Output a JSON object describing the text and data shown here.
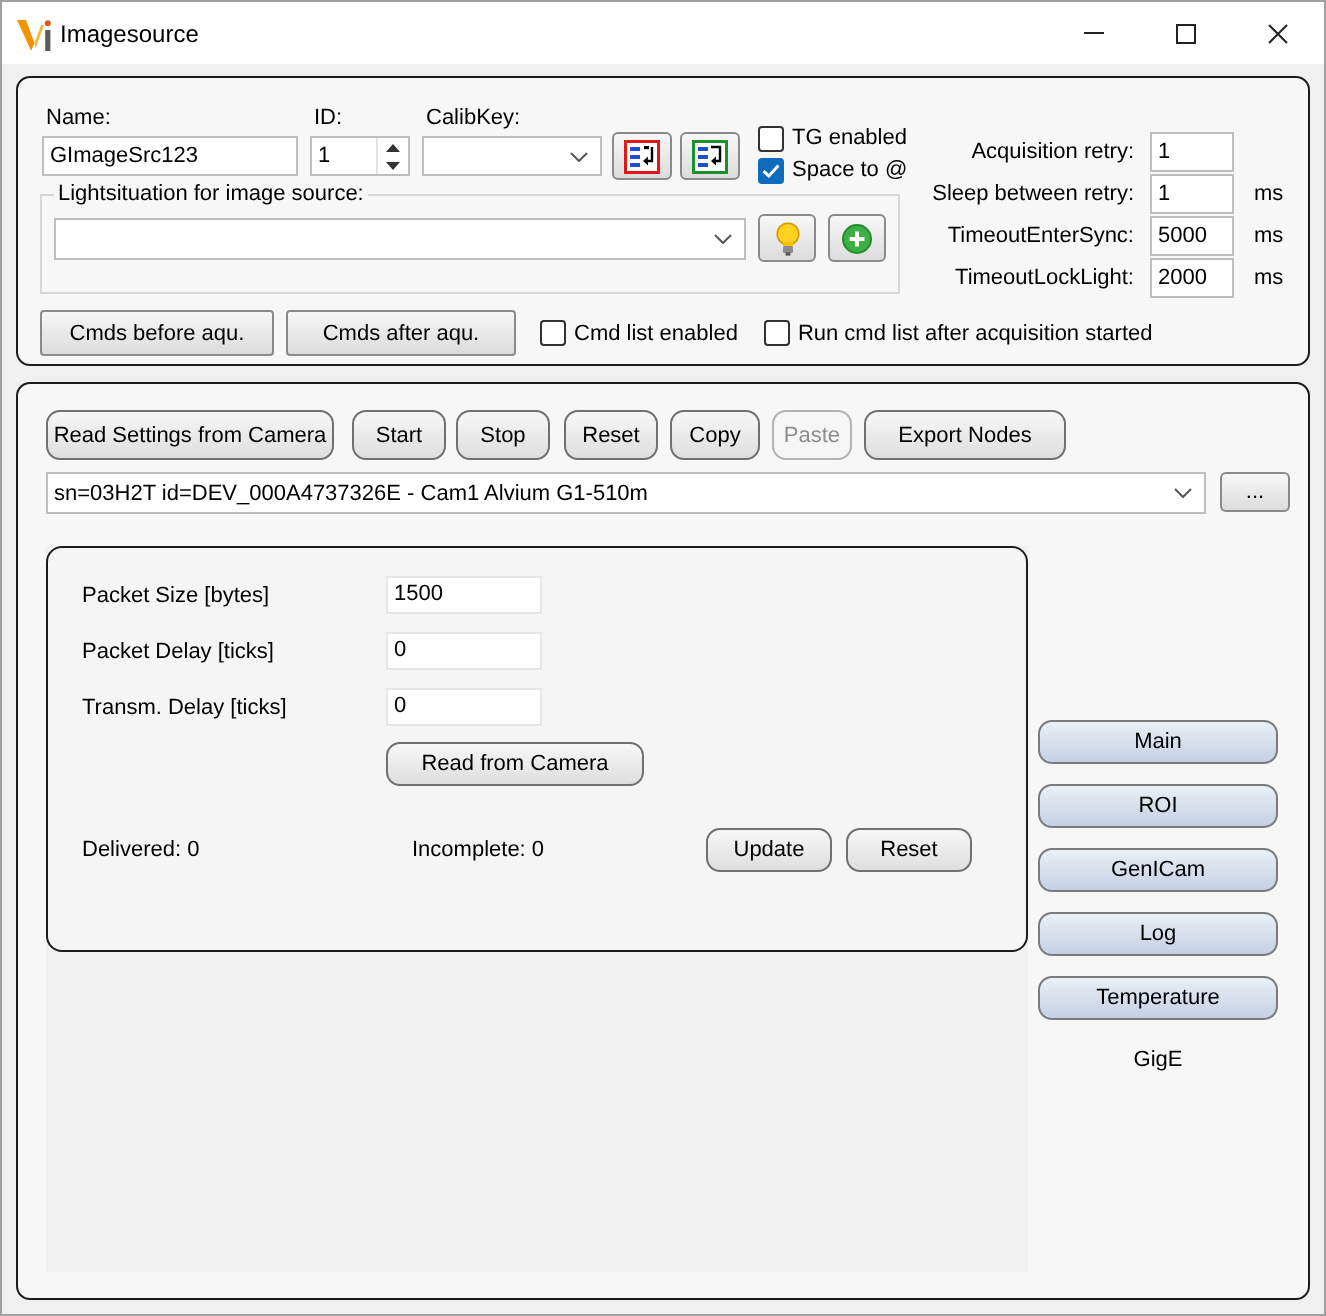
{
  "window": {
    "title": "Imagesource"
  },
  "source": {
    "fields": [
      {
        "kind": "text",
        "label": "Name:",
        "value": "GImageSrc123"
      },
      {
        "kind": "spin",
        "label": "ID:",
        "value": "1"
      },
      {
        "kind": "combo",
        "label": "CalibKey:"
      }
    ],
    "options": [
      {
        "label": "TG enabled",
        "checked": false
      },
      {
        "label": "Space to @",
        "checked": true
      }
    ],
    "light_situation": {
      "title": "Lightsituation for image source:"
    },
    "retry_settings": [
      {
        "label": "Acquisition retry:",
        "value": "1"
      },
      {
        "label": "Sleep between retry:",
        "value": "1",
        "unit": "ms"
      },
      {
        "label": "TimeoutEnterSync:",
        "value": "5000",
        "unit": "ms"
      },
      {
        "label": "TimeoutLockLight:",
        "value": "2000",
        "unit": "ms"
      }
    ],
    "cmd_buttons": [
      "Cmds before aqu.",
      "Cmds after aqu."
    ],
    "cmd_options": [
      {
        "label": "Cmd list enabled",
        "checked": false
      },
      {
        "label": "Run cmd list after acquisition started",
        "checked": false
      }
    ]
  },
  "camera": {
    "toolbar": [
      {
        "label": "Read Settings from Camera",
        "disabled": false
      },
      {
        "label": "Start",
        "disabled": false
      },
      {
        "label": "Stop",
        "disabled": false
      },
      {
        "label": "Reset",
        "disabled": false
      },
      {
        "label": "Copy",
        "disabled": false
      },
      {
        "label": "Paste",
        "disabled": true
      },
      {
        "label": "Export Nodes",
        "disabled": false
      }
    ],
    "device": {
      "value": "sn=03H2T id=DEV_000A4737326E - Cam1 Alvium G1-510m"
    },
    "browse_button": "...",
    "gige": {
      "params": [
        {
          "label": "Packet Size [bytes]",
          "value": "1500"
        },
        {
          "label": "Packet Delay [ticks]",
          "value": "0"
        },
        {
          "label": "Transm. Delay [ticks]",
          "value": "0"
        }
      ],
      "read_button": "Read from Camera",
      "stats": [
        "Delivered: 0",
        "Incomplete: 0"
      ],
      "buttons": [
        "Update",
        "Reset"
      ]
    },
    "pages": [
      "Main",
      "ROI",
      "GenICam",
      "Log",
      "Temperature"
    ],
    "interface": "GigE"
  }
}
